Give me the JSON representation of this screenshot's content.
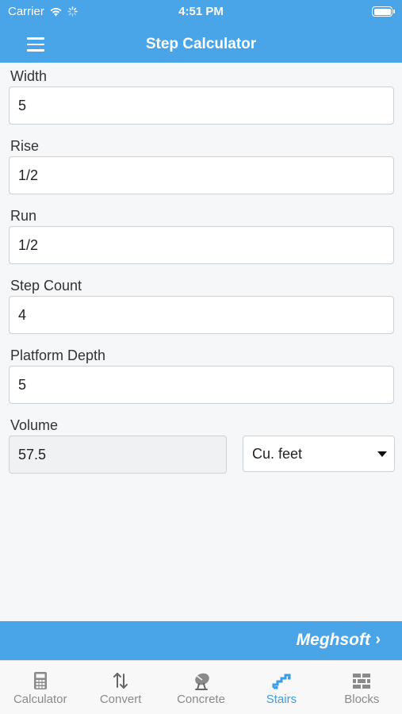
{
  "status_bar": {
    "carrier": "Carrier",
    "time": "4:51 PM"
  },
  "navbar": {
    "title": "Step Calculator"
  },
  "form": {
    "width": {
      "label": "Width",
      "value": "5"
    },
    "rise": {
      "label": "Rise",
      "value": "1/2"
    },
    "run": {
      "label": "Run",
      "value": "1/2"
    },
    "step_count": {
      "label": "Step Count",
      "value": "4"
    },
    "platform_depth": {
      "label": "Platform Depth",
      "value": "5"
    },
    "volume": {
      "label": "Volume",
      "value": "57.5",
      "unit_selected": "Cu. feet"
    }
  },
  "banner": {
    "text": "Meghsoft",
    "arrow": "›"
  },
  "tabs": [
    {
      "label": "Calculator",
      "icon": "calculator-icon",
      "active": false
    },
    {
      "label": "Convert",
      "icon": "convert-arrows-icon",
      "active": false
    },
    {
      "label": "Concrete",
      "icon": "concrete-mixer-icon",
      "active": false
    },
    {
      "label": "Stairs",
      "icon": "stairs-icon",
      "active": true
    },
    {
      "label": "Blocks",
      "icon": "blocks-icon",
      "active": false
    }
  ],
  "colors": {
    "accent": "#4aa4e8",
    "active_tab": "#3a9ee6",
    "inactive_tab": "#8a8a8a"
  }
}
